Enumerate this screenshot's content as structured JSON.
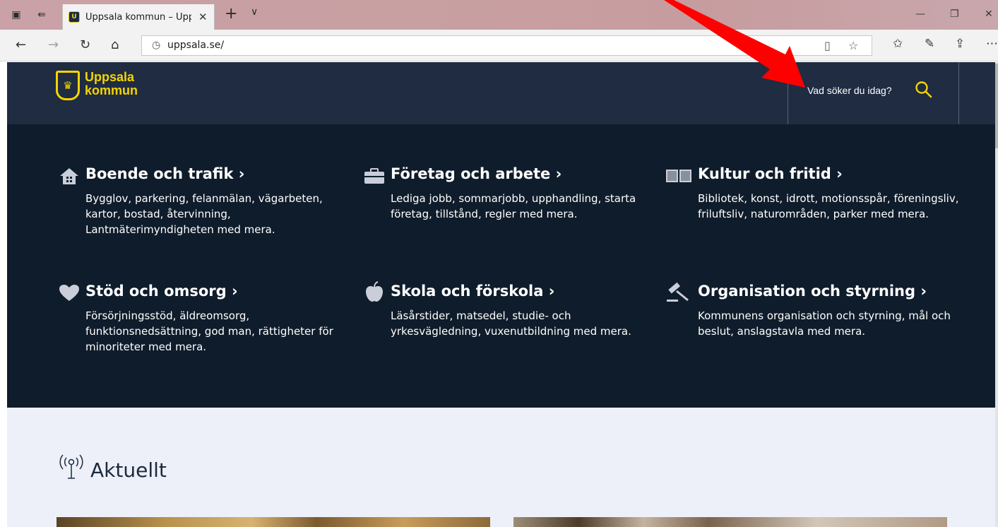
{
  "browser": {
    "tab_title": "Uppsala kommun – Upp",
    "tab_close": "✕",
    "new_tab": "+",
    "tab_menu": "∨",
    "address": "uppsala.se/",
    "window_controls": [
      "—",
      "❐",
      "✕"
    ]
  },
  "header": {
    "logo_line1": "Uppsala",
    "logo_line2": "kommun",
    "search_placeholder": "Vad söker du idag?"
  },
  "categories": [
    {
      "title": "Boende och trafik ›",
      "description": "Bygglov, parkering, felanmälan, vägarbeten, kartor, bostad, återvinning, Lantmäterimyndigheten med mera.",
      "icon": "house-icon"
    },
    {
      "title": "Företag och arbete ›",
      "description": "Lediga jobb, sommarjobb, upphandling, starta företag, tillstånd, regler med mera.",
      "icon": "briefcase-icon"
    },
    {
      "title": "Kultur och fritid ›",
      "description": "Bibliotek, konst, idrott, motionsspår, föreningsliv, friluftsliv, naturområden, parker med mera.",
      "icon": "book-icon"
    },
    {
      "title": "Stöd och omsorg ›",
      "description": "Försörjningsstöd, äldreomsorg, funktionsnedsättning, god man, rättigheter för minoriteter med mera.",
      "icon": "heart-icon"
    },
    {
      "title": "Skola och förskola ›",
      "description": "Läsårstider, matsedel, studie- och yrkesvägledning, vuxenutbildning med mera.",
      "icon": "apple-icon"
    },
    {
      "title": "Organisation och styrning ›",
      "description": "Kommunens organisation och styrning, mål och beslut, anslagstavla med mera.",
      "icon": "gavel-icon"
    }
  ],
  "news": {
    "title": "Aktuellt",
    "icon": "broadcast-icon"
  },
  "colors": {
    "header_bg": "#1f2c42",
    "category_bg": "#0f1c2b",
    "accent_yellow": "#f5d400",
    "news_bg": "#edf0f9",
    "annotation_arrow": "#ff0000"
  }
}
